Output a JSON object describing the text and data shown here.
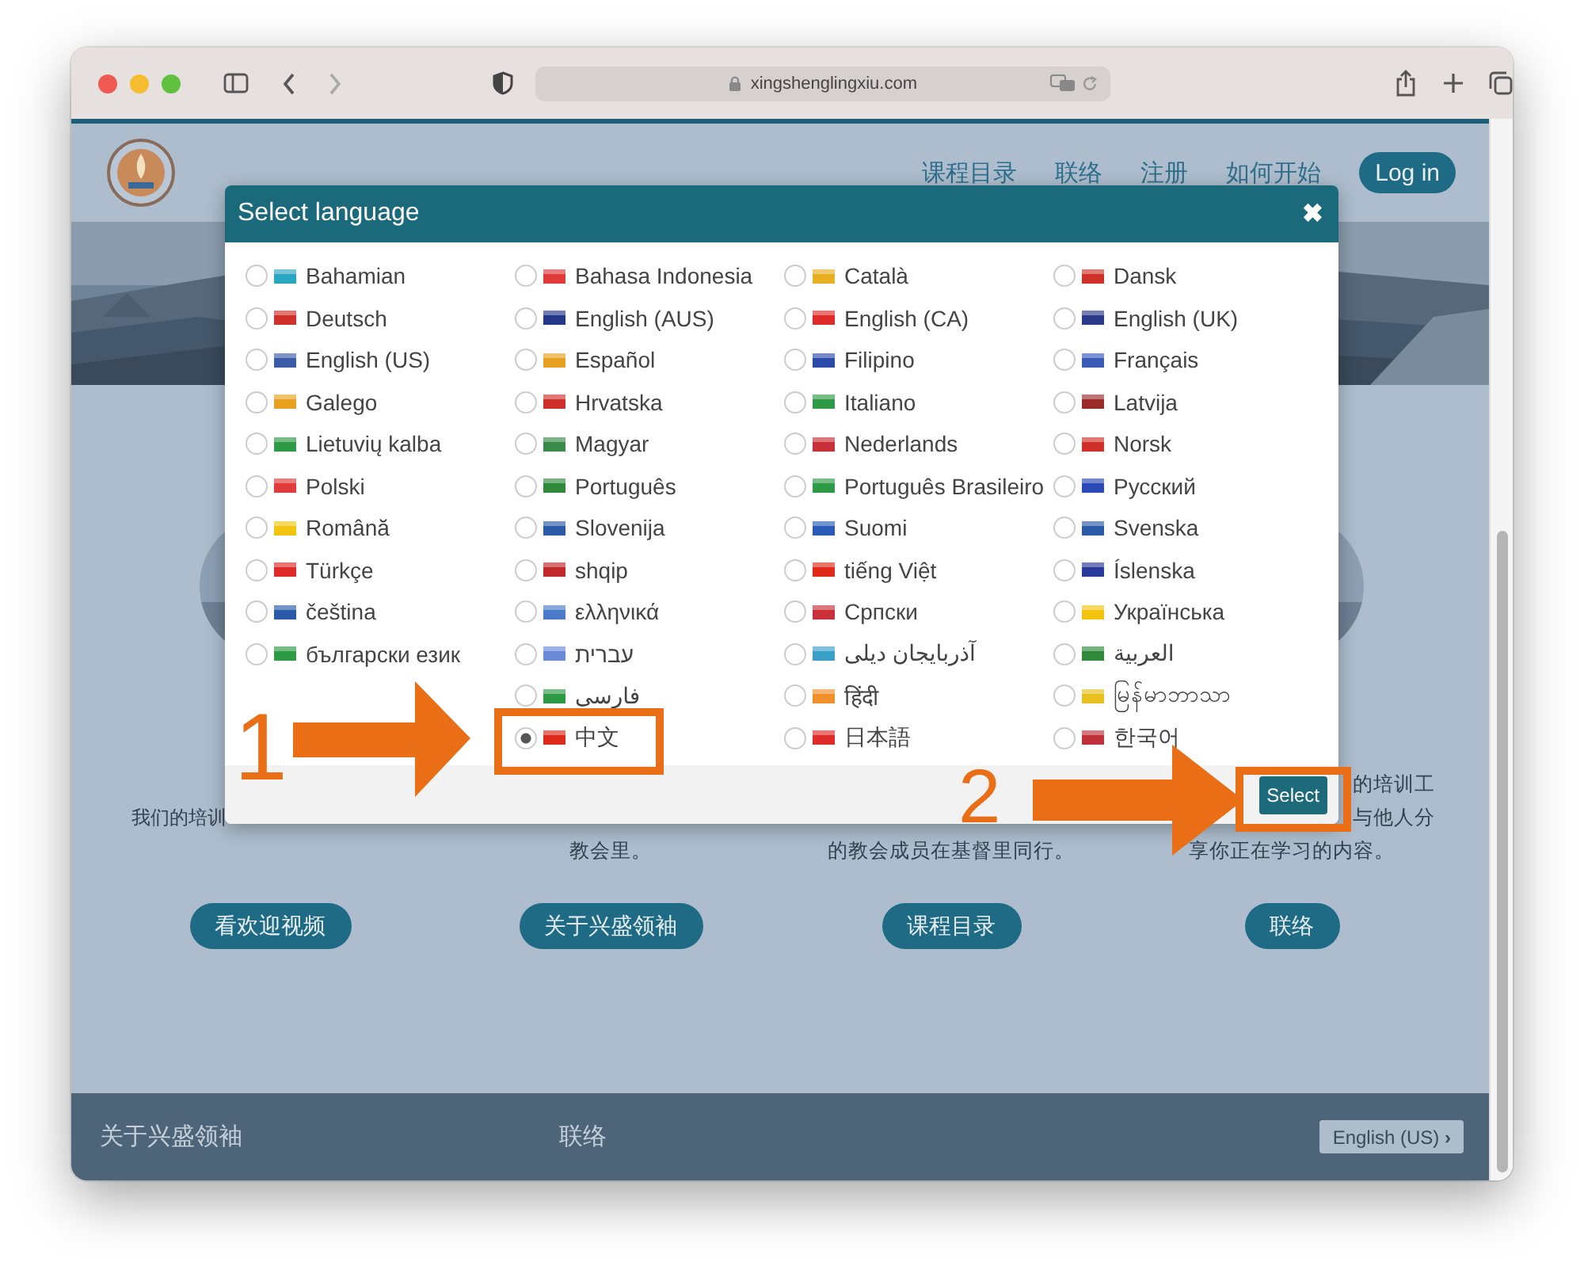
{
  "browser": {
    "url": "xingshenglingxiu.com"
  },
  "header": {
    "nav": [
      "课程目录",
      "联络",
      "注册",
      "如何开始"
    ],
    "login": "Log in"
  },
  "features": [
    {
      "upper": [
        "我们的培训"
      ],
      "button": "看欢迎视频"
    },
    {
      "lower": [
        "教会里。"
      ],
      "button": "关于兴盛领袖"
    },
    {
      "lower": [
        "的教会成员在基督里同行。"
      ],
      "button": "课程目录"
    },
    {
      "upper": [
        "的培训工",
        "与他人分"
      ],
      "lower": [
        "享你正在学习的内容。"
      ],
      "button": "联络"
    }
  ],
  "footer": {
    "links": [
      "关于兴盛领袖",
      "联络"
    ],
    "language_button": "English (US)",
    "chevron": "›"
  },
  "modal": {
    "title": "Select language",
    "close": "✖",
    "button": "Select",
    "columns": [
      [
        {
          "label": "Bahamian",
          "color": "#2aa7c0",
          "selected": false
        },
        {
          "label": "Deutsch",
          "color": "#d0302a",
          "selected": false
        },
        {
          "label": "English (US)",
          "color": "#3b5aa8",
          "selected": false
        },
        {
          "label": "Galego",
          "color": "#e8a020",
          "selected": false
        },
        {
          "label": "Lietuvių kalba",
          "color": "#2e9a45",
          "selected": false
        },
        {
          "label": "Polski",
          "color": "#e03a3a",
          "selected": false
        },
        {
          "label": "Română",
          "color": "#f2c40f",
          "selected": false
        },
        {
          "label": "Türkçe",
          "color": "#e02b2b",
          "selected": false
        },
        {
          "label": "čeština",
          "color": "#2a5aa8",
          "selected": false
        },
        {
          "label": "български език",
          "color": "#2e9a45",
          "selected": false
        }
      ],
      [
        {
          "label": "Bahasa Indonesia",
          "color": "#e03a3a",
          "selected": false
        },
        {
          "label": "English (AUS)",
          "color": "#24388a",
          "selected": false
        },
        {
          "label": "Español",
          "color": "#e8a020",
          "selected": false
        },
        {
          "label": "Hrvatska",
          "color": "#d0302a",
          "selected": false
        },
        {
          "label": "Magyar",
          "color": "#3a8a4a",
          "selected": false
        },
        {
          "label": "Português",
          "color": "#2e8a3a",
          "selected": false
        },
        {
          "label": "Slovenija",
          "color": "#2a5aa8",
          "selected": false
        },
        {
          "label": "shqip",
          "color": "#c0282a",
          "selected": false
        },
        {
          "label": "ελληνικά",
          "color": "#4a7ac8",
          "selected": false
        },
        {
          "label": "עברית",
          "color": "#6a8ad8",
          "selected": false
        },
        {
          "label": "فارسی",
          "color": "#2e9a45",
          "selected": false
        },
        {
          "label": "中文",
          "color": "#de2a1a",
          "selected": true
        }
      ],
      [
        {
          "label": "Català",
          "color": "#e8b020",
          "selected": false
        },
        {
          "label": "English (CA)",
          "color": "#e02b2b",
          "selected": false
        },
        {
          "label": "Filipino",
          "color": "#2a4aa8",
          "selected": false
        },
        {
          "label": "Italiano",
          "color": "#2e9a45",
          "selected": false
        },
        {
          "label": "Nederlands",
          "color": "#c8303a",
          "selected": false
        },
        {
          "label": "Português Brasileiro",
          "color": "#2e9a45",
          "selected": false
        },
        {
          "label": "Suomi",
          "color": "#2a5ab8",
          "selected": false
        },
        {
          "label": "tiếng Việt",
          "color": "#e02b1a",
          "selected": false
        },
        {
          "label": "Српски",
          "color": "#c8303a",
          "selected": false
        },
        {
          "label": "آذربايجان ديلی",
          "color": "#3aa0c8",
          "selected": false
        },
        {
          "label": "हिंदी",
          "color": "#f0902a",
          "selected": false
        },
        {
          "label": "日本語",
          "color": "#e02b2b",
          "selected": false
        }
      ],
      [
        {
          "label": "Dansk",
          "color": "#d0302a",
          "selected": false
        },
        {
          "label": "English (UK)",
          "color": "#2a3a8a",
          "selected": false
        },
        {
          "label": "Français",
          "color": "#3a5ab8",
          "selected": false
        },
        {
          "label": "Latvija",
          "color": "#9a2a2a",
          "selected": false
        },
        {
          "label": "Norsk",
          "color": "#d0302a",
          "selected": false
        },
        {
          "label": "Русский",
          "color": "#2a4ab8",
          "selected": false
        },
        {
          "label": "Svenska",
          "color": "#2a5aa8",
          "selected": false
        },
        {
          "label": "Íslenska",
          "color": "#2a3a9a",
          "selected": false
        },
        {
          "label": "Українська",
          "color": "#f2c40f",
          "selected": false
        },
        {
          "label": "العربية",
          "color": "#2e8a3a",
          "selected": false
        },
        {
          "label": "မြန်မာဘာသာ",
          "color": "#e8c020",
          "selected": false
        },
        {
          "label": "한국어",
          "color": "#c0303a",
          "selected": false
        }
      ]
    ]
  },
  "annotations": [
    {
      "label": "1"
    },
    {
      "label": "2"
    }
  ]
}
